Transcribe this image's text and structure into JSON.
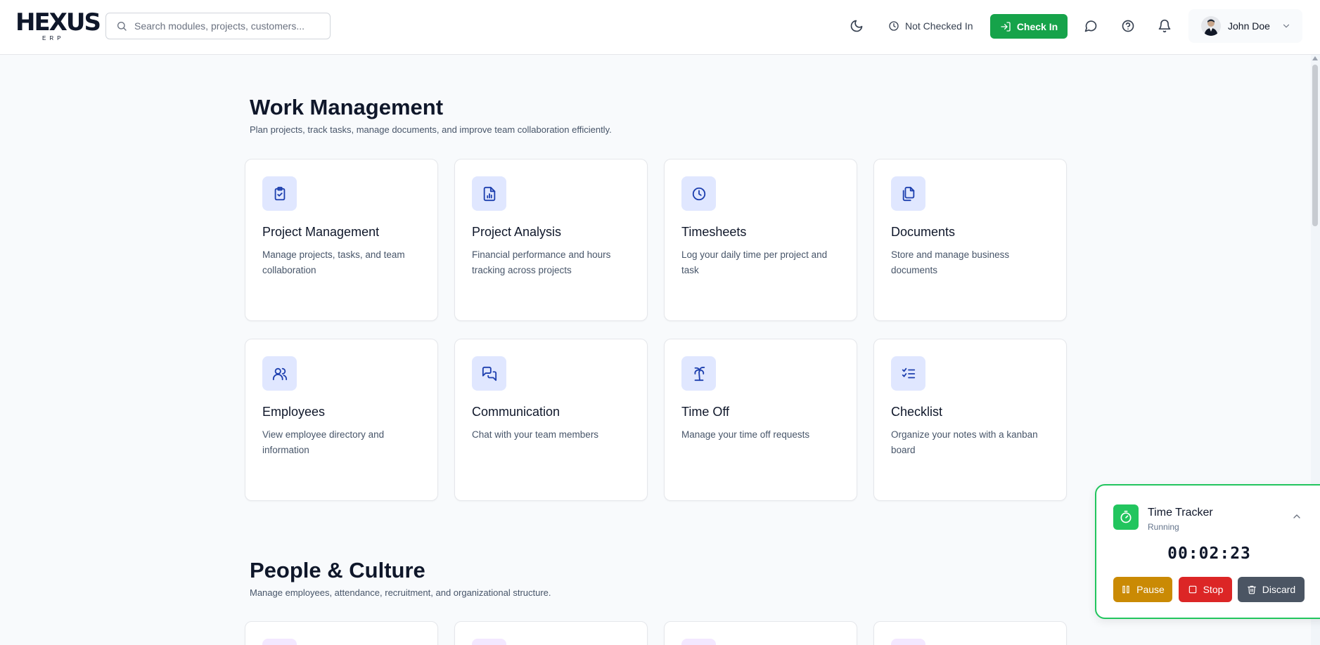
{
  "header": {
    "logo_text": "HEXUS",
    "logo_sub": "ERP",
    "search_placeholder": "Search modules, projects, customers...",
    "checkin_status": "Not Checked In",
    "checkin_label": "Check In",
    "user_name": "John Doe"
  },
  "sections": [
    {
      "title": "Work Management",
      "description": "Plan projects, track tasks, manage documents, and improve team collaboration efficiently.",
      "cards": [
        {
          "title": "Project Management",
          "description": "Manage projects, tasks, and team collaboration",
          "icon": "clipboard-check-icon"
        },
        {
          "title": "Project Analysis",
          "description": "Financial performance and hours tracking across projects",
          "icon": "chart-file-icon"
        },
        {
          "title": "Timesheets",
          "description": "Log your daily time per project and task",
          "icon": "clock-icon"
        },
        {
          "title": "Documents",
          "description": "Store and manage business documents",
          "icon": "documents-icon"
        },
        {
          "title": "Employees",
          "description": "View employee directory and information",
          "icon": "users-icon"
        },
        {
          "title": "Communication",
          "description": "Chat with your team members",
          "icon": "chat-icon"
        },
        {
          "title": "Time Off",
          "description": "Manage your time off requests",
          "icon": "palm-tree-icon"
        },
        {
          "title": "Checklist",
          "description": "Organize your notes with a kanban board",
          "icon": "checklist-icon"
        }
      ]
    },
    {
      "title": "People & Culture",
      "description": "Manage employees, attendance, recruitment, and organizational structure."
    }
  ],
  "tracker": {
    "title": "Time Tracker",
    "status": "Running",
    "time": "00:02:23",
    "pause_label": "Pause",
    "stop_label": "Stop",
    "discard_label": "Discard"
  },
  "colors": {
    "accent_green": "#16a34a",
    "tracker_green": "#22c55e",
    "pause": "#ca8a04",
    "stop": "#dc2626",
    "discard": "#4b5563",
    "icon_bg": "#e0e7ff",
    "icon_fg": "#1e40af"
  }
}
